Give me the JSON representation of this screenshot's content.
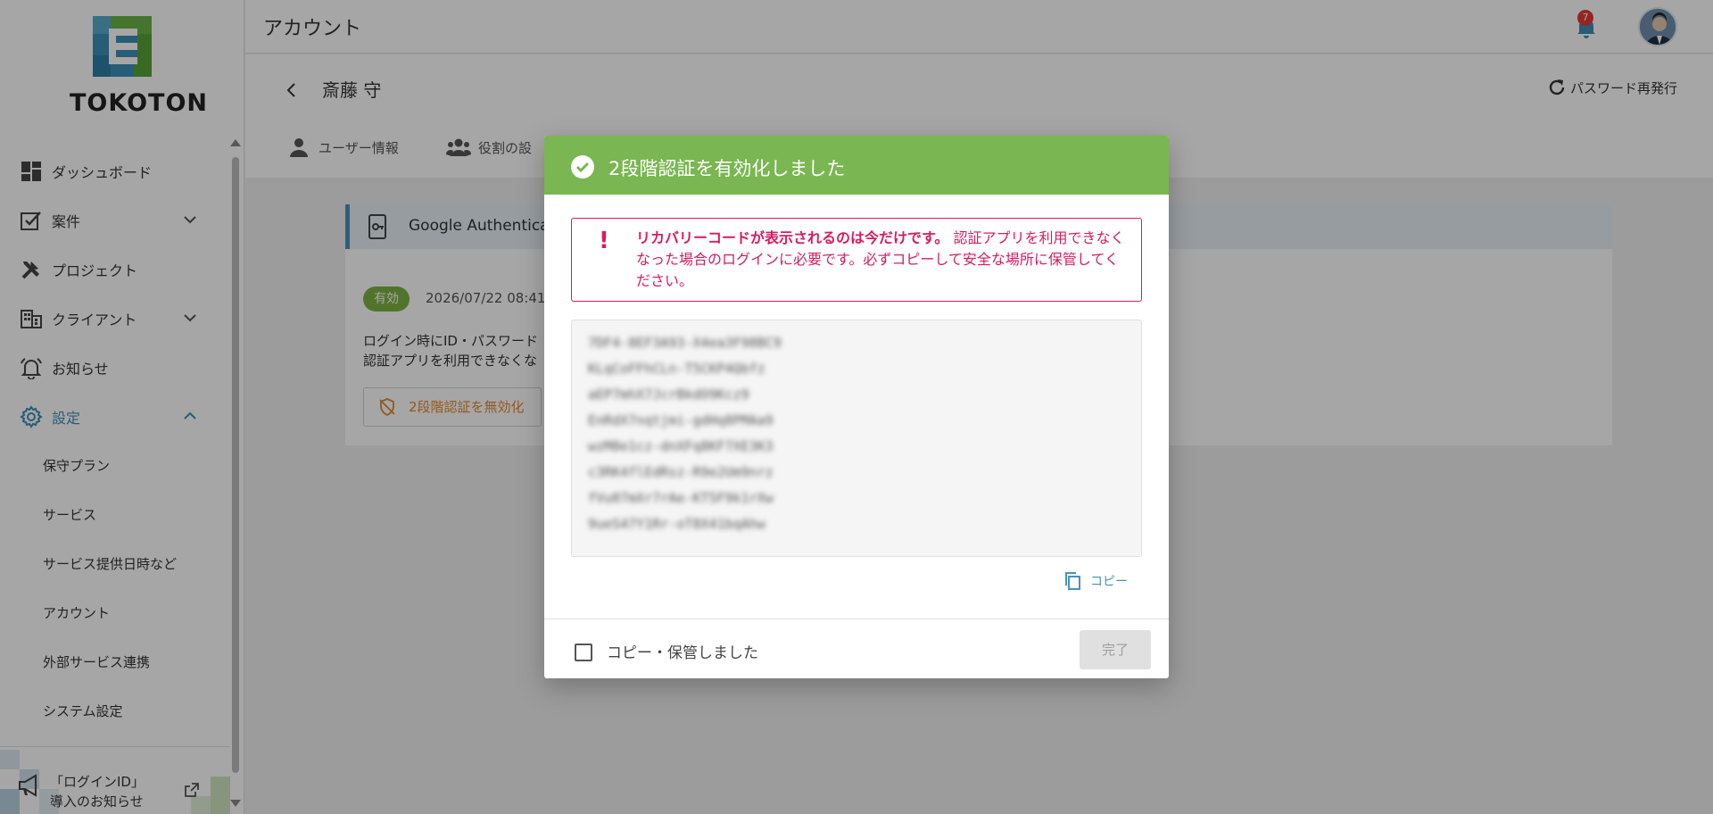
{
  "brand": {
    "name": "TOKOTON",
    "colors": {
      "blue": "#3d8fb6",
      "green": "#7ab651",
      "pink": "#d81b60"
    }
  },
  "sidebar": {
    "items": [
      {
        "label": "ダッシュボード",
        "icon": "dashboard-icon"
      },
      {
        "label": "案件",
        "icon": "task-check-icon",
        "expandable": true
      },
      {
        "label": "プロジェクト",
        "icon": "tools-icon"
      },
      {
        "label": "クライアント",
        "icon": "building-icon",
        "expandable": true
      },
      {
        "label": "お知らせ",
        "icon": "bell-icon"
      },
      {
        "label": "設定",
        "icon": "gear-icon",
        "expanded": true,
        "active": true
      }
    ],
    "subitems": [
      {
        "label": "保守プラン"
      },
      {
        "label": "サービス"
      },
      {
        "label": "サービス提供日時など"
      },
      {
        "label": "アカウント"
      },
      {
        "label": "外部サービス連携"
      },
      {
        "label": "システム設定"
      }
    ],
    "notice": {
      "line1": "「ログインID」",
      "line2": "導入のお知らせ"
    }
  },
  "header": {
    "title": "アカウント",
    "notification_count": "7"
  },
  "page": {
    "user_name": "斎藤 守",
    "reissue_label": "パスワード再発行",
    "tabs": [
      {
        "label": "ユーザー情報"
      },
      {
        "label": "役割の設"
      }
    ]
  },
  "card": {
    "title": "Google Authenticato",
    "status": "有効",
    "date": "2026/07/22 08:41",
    "desc1": "ログイン時にID・パスワード",
    "desc2": "認証アプリを利用できなくな",
    "disable_label": "2段階認証を無効化"
  },
  "modal": {
    "title": "2段階認証を有効化しました",
    "warning_bold": "リカバリーコードが表示されるのは今だけです。",
    "warning_text": "認証アプリを利用できなくなった場合のログインに必要です。必ずコピーして安全な場所に保管してください。",
    "codes": [
      "7DF4-8EF3A93-X4ea3F98BC9",
      "KLqCoFFhCLn-T5CKP4Qbfz",
      "aEP7mhX7JcrBkdO9Kcz9",
      "EnRdX7nqtjmi-gdHq8PMAa9",
      "wzM8e1cz-dnXFq8KF7XE3K3",
      "c3RK4flEdRsz-R9e2Um9nrz",
      "fVu07mXr7rAe-KT5F9k1rXw",
      "9ueS47Y1Rr-oT8X41bqAhw"
    ],
    "copy_label": "コピー",
    "checkbox_label": "コピー・保管しました",
    "done_label": "完了"
  }
}
